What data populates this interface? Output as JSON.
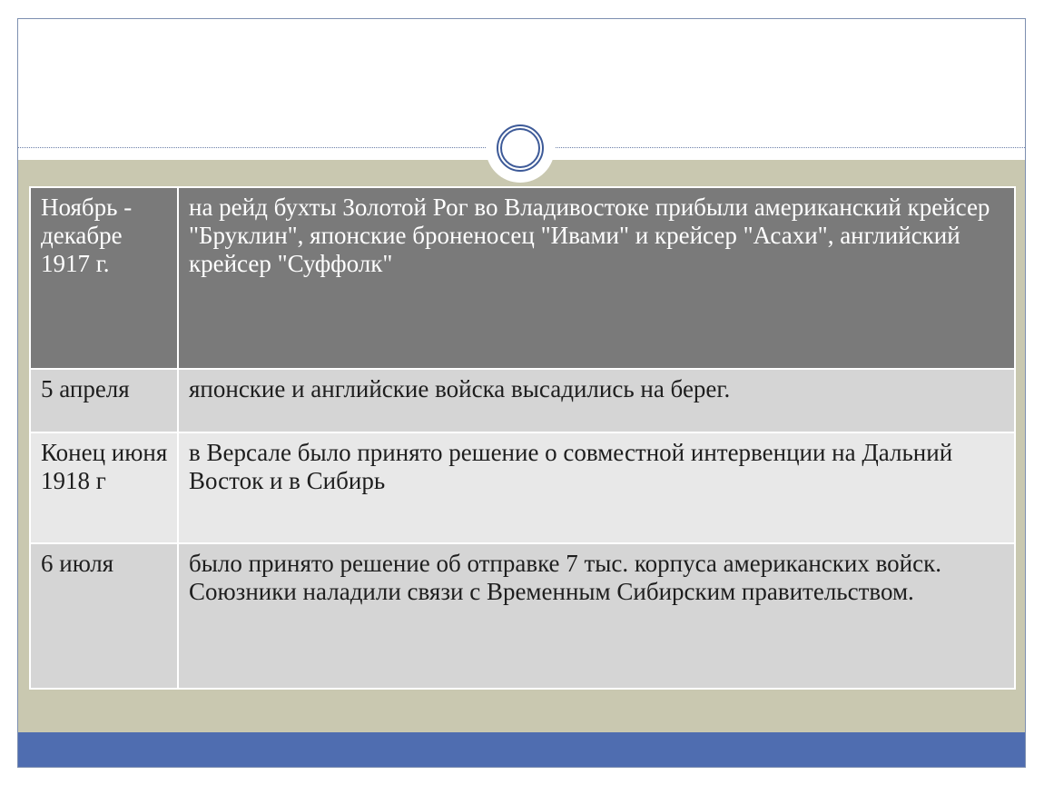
{
  "slide": {
    "colors": {
      "header_row": "#7a7a7a",
      "row_dark": "#d5d5d5",
      "row_light": "#e8e8e8",
      "band": "#c9c8b0",
      "bottom_bar": "#4f6db0",
      "ornament": "#3d5a98"
    },
    "table": {
      "rows": [
        {
          "date": "Ноябрь - декабре 1917 г.",
          "event": "на рейд бухты Золотой Рог во Владивостоке прибыли американский крейсер \"Бруклин\", японские броненосец \"Ивами\" и крейсер \"Асахи\", английский крейсер \"Суффолк\""
        },
        {
          "date": "5 апреля",
          "event": "японские и английские войска высадились на берег."
        },
        {
          "date": "Конец июня 1918 г",
          "event": " в Версале было принято решение о совместной интервенции на Дальний Восток и в Сибирь"
        },
        {
          "date": "6 июля",
          "event": "было принято решение об отправке 7 тыс. корпуса американских войск. Союзники наладили связи с Временным Сибирским правительством."
        }
      ]
    }
  }
}
